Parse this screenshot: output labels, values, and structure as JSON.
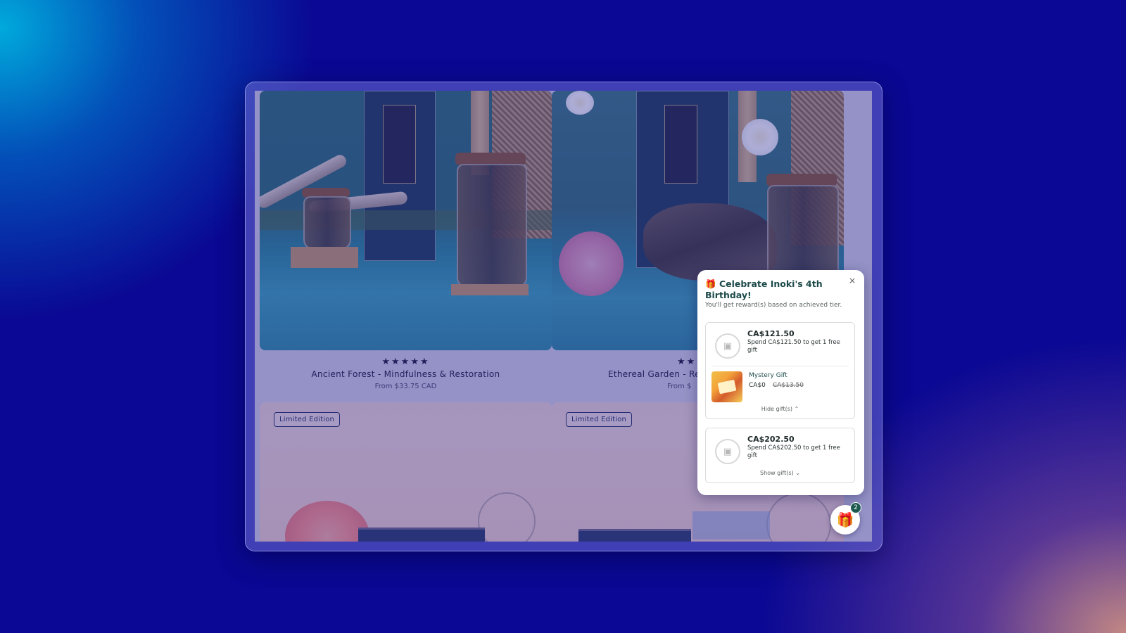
{
  "products": [
    {
      "rating_stars": "★★★★★",
      "title": "Ancient Forest - Mindfulness & Restoration",
      "price": "From $33.75 CAD"
    },
    {
      "rating_stars": "★★",
      "title": "Ethereal Garden - Re",
      "price": "From $"
    }
  ],
  "lower_cards": [
    {
      "badge": "Limited Edition"
    },
    {
      "badge": "Limited Edition"
    }
  ],
  "popup": {
    "title_icon": "gift-icon",
    "title": "Celebrate Inoki's 4th Birthday!",
    "subtitle": "You'll get reward(s) based on achieved tier.",
    "close": "×",
    "tiers": [
      {
        "amount": "CA$121.50",
        "description": "Spend CA$121.50 to get 1 free gift",
        "gift": {
          "name": "Mystery Gift",
          "price": "CA$0",
          "original_price": "CA$13.50"
        },
        "toggle": "Hide gift(s) ⌃"
      },
      {
        "amount": "CA$202.50",
        "description": "Spend CA$202.50 to get 1 free gift",
        "toggle": "Show gift(s) ⌄"
      }
    ]
  },
  "launcher": {
    "icon": "gift-icon",
    "count": "2"
  },
  "colors": {
    "background": "#0a0894",
    "accent": "#1d4a4a",
    "badge_border": "#22305e"
  }
}
